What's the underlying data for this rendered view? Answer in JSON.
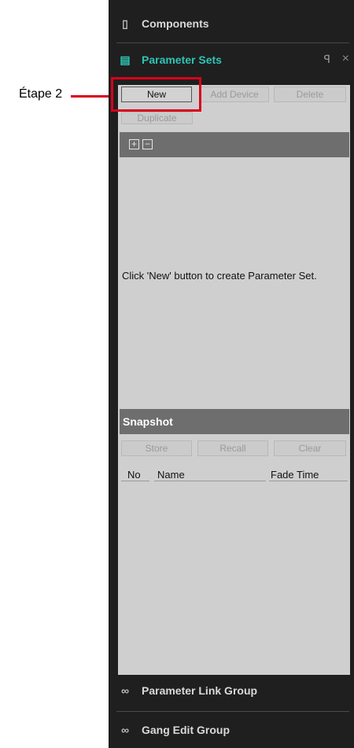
{
  "callout": {
    "label": "Étape 2"
  },
  "panel": {
    "components_title": "Components",
    "parameter_sets_title": "Parameter Sets",
    "pin_glyph": "ꟼ",
    "close_glyph": "×",
    "buttons": {
      "new": "New",
      "add_device": "Add Device",
      "delete": "Delete",
      "duplicate": "Duplicate"
    },
    "tree": {
      "expand_glyph": "+",
      "collapse_glyph": "−"
    },
    "hint": "Click 'New' button to create Parameter Set.",
    "snapshot": {
      "title": "Snapshot",
      "buttons": {
        "store": "Store",
        "recall": "Recall",
        "clear": "Clear"
      },
      "columns": [
        "No",
        "Name",
        "Fade Time"
      ]
    },
    "parameter_link_group": "Parameter Link Group",
    "gang_edit_group": "Gang Edit Group"
  },
  "icons": {
    "components": "components-icon",
    "parameter_sets": "parameter-sets-icon",
    "link": "link-icon"
  },
  "colors": {
    "accent": "#2ec5b4",
    "callout": "#d9001b",
    "panel_bg": "#1f1f1f",
    "content_bg": "#cfcfcf"
  }
}
